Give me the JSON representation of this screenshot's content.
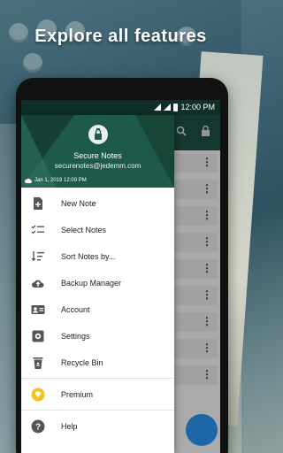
{
  "headline": "Explore all features",
  "status_bar": {
    "time": "12:00 PM"
  },
  "drawer": {
    "app_name": "Secure Notes",
    "email": "securenotes@jedemm.com",
    "last_sync": "Jan 1, 2019 12:00 PM",
    "items": [
      {
        "label": "New Note",
        "icon": "new-note-icon"
      },
      {
        "label": "Select Notes",
        "icon": "checklist-icon"
      },
      {
        "label": "Sort Notes by...",
        "icon": "sort-icon"
      },
      {
        "label": "Backup Manager",
        "icon": "cloud-upload-icon"
      },
      {
        "label": "Account",
        "icon": "account-card-icon"
      },
      {
        "label": "Settings",
        "icon": "settings-icon"
      },
      {
        "label": "Recycle Bin",
        "icon": "recycle-bin-icon"
      },
      {
        "label": "Premium",
        "icon": "premium-diamond-icon"
      },
      {
        "label": "Help",
        "icon": "help-icon"
      }
    ]
  },
  "colors": {
    "primary": "#1e5a4b",
    "primary_dark": "#0f2f28",
    "accent_premium": "#f2c318",
    "fab": "#2a8fe6"
  }
}
